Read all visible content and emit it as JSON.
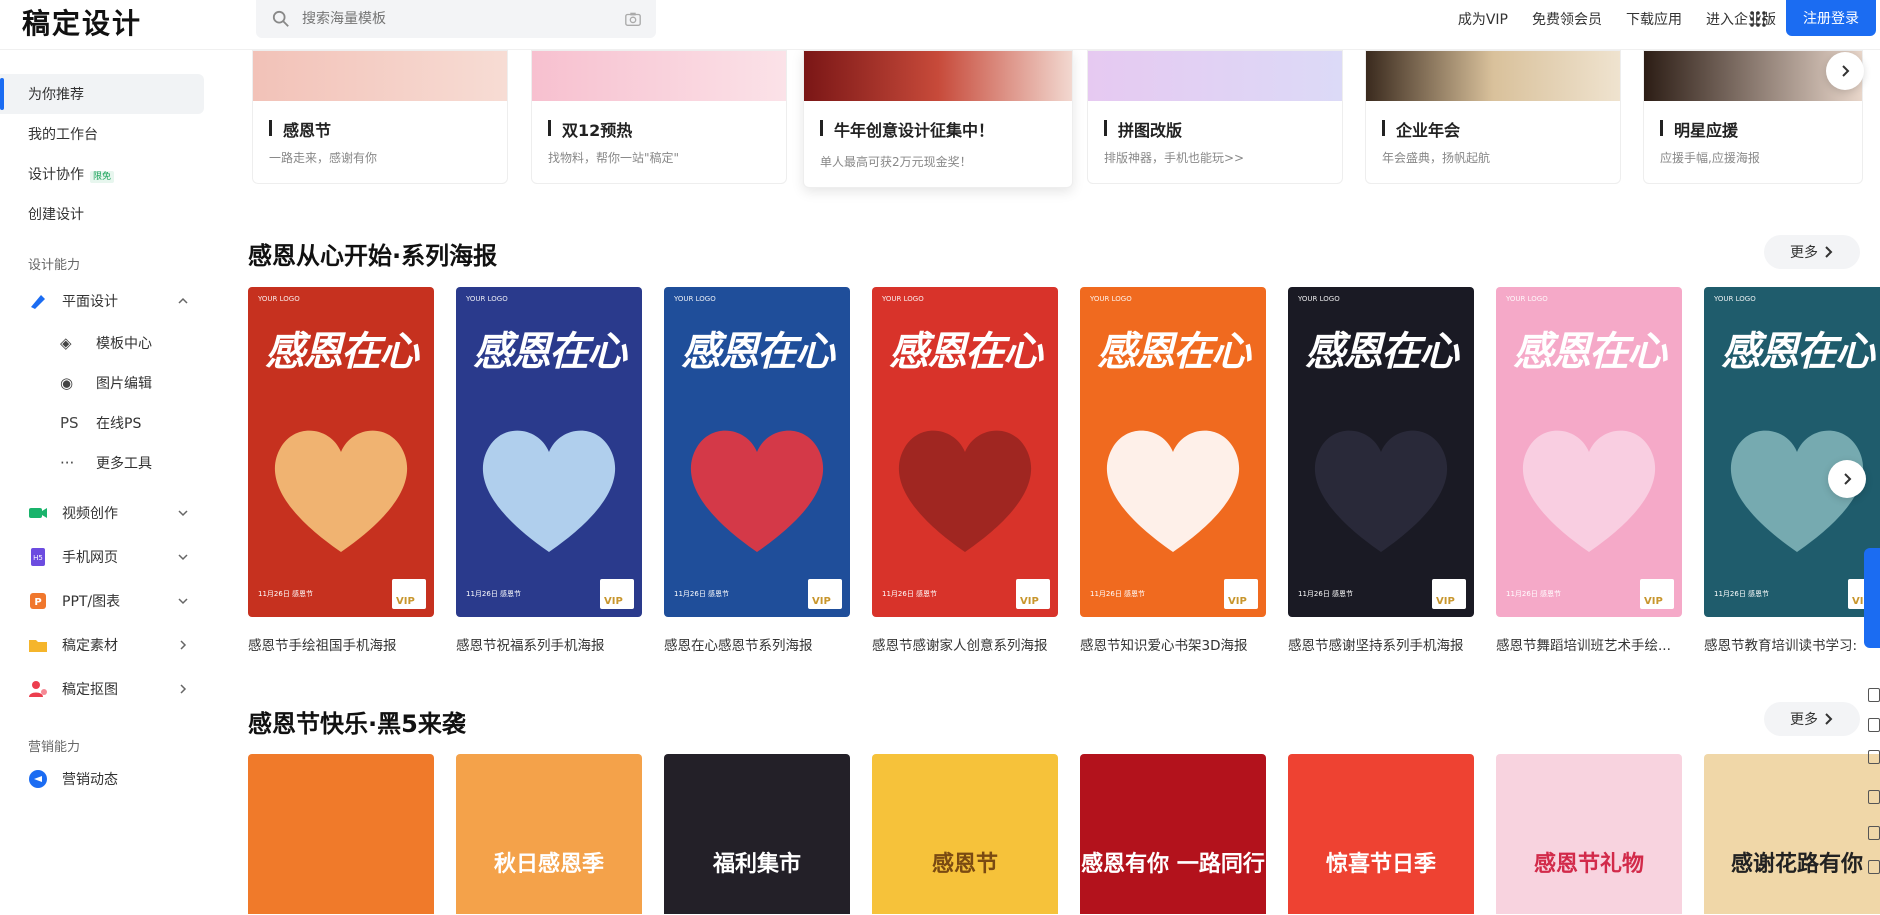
{
  "header": {
    "logo": "稿定设计",
    "search_placeholder": "搜索海量模板",
    "nav": [
      "成为VIP",
      "免费领会员",
      "下载应用",
      "进入企业版"
    ],
    "register_label": "注册登录"
  },
  "sidebar": {
    "items": [
      {
        "label": "为你推荐",
        "active": true
      },
      {
        "label": "我的工作台"
      },
      {
        "label": "设计协作",
        "badge": "限免"
      },
      {
        "label": "创建设计"
      }
    ],
    "section_design": "设计能力",
    "categories": [
      {
        "label": "平面设计",
        "icon": "pen-icon",
        "color": "#1b6cf2",
        "expanded": true
      },
      {
        "label": "视频创作",
        "icon": "video-icon",
        "color": "#19b36b"
      },
      {
        "label": "手机网页",
        "icon": "h5-icon",
        "color": "#6c4ce0"
      },
      {
        "label": "PPT/图表",
        "icon": "ppt-icon",
        "color": "#f0772d"
      },
      {
        "label": "稿定素材",
        "icon": "folder-icon",
        "color": "#f5b52b"
      },
      {
        "label": "稿定抠图",
        "icon": "cutout-icon",
        "color": "#ec3e4e"
      }
    ],
    "sub_items": [
      {
        "label": "模板中心",
        "icon": "layers-icon",
        "glyph": "◈"
      },
      {
        "label": "图片编辑",
        "icon": "edit-icon",
        "glyph": "◉"
      },
      {
        "label": "在线PS",
        "icon": "ps-icon",
        "glyph": "PS"
      },
      {
        "label": "更多工具",
        "icon": "more-icon",
        "glyph": "···"
      }
    ],
    "section_marketing": "营销能力",
    "marketing": {
      "label": "营销动态",
      "icon": "marketing-icon",
      "color": "#1b6cf2"
    }
  },
  "banners": [
    {
      "title": "感恩节",
      "subtitle": "一路走来，感谢有你",
      "color": "#f4c9c2"
    },
    {
      "title": "双12预热",
      "subtitle": "找物料，帮你一站\"稿定\"",
      "color": "#f9d1da"
    },
    {
      "title": "牛年创意设计征集中！",
      "subtitle": "单人最高可获2万元现金奖！",
      "color": "#8e1d1d"
    },
    {
      "title": "拼图改版",
      "subtitle": "排版神器，手机也能玩>>",
      "color": "#d9d6f5"
    },
    {
      "title": "企业年会",
      "subtitle": "年会盛典，扬帆起航",
      "color": "#e7d3b3"
    },
    {
      "title": "明星应援",
      "subtitle": "应援手幅,应援海报",
      "color": "#e8d4c8"
    }
  ],
  "section1": {
    "title": "感恩从心开始·系列海报",
    "more": "更多",
    "posters": [
      {
        "caption": "感恩节手绘祖国手机海报",
        "bg": "#c6311f",
        "heart": "#f4c27a"
      },
      {
        "caption": "感恩节祝福系列手机海报",
        "bg": "#2a3a8c",
        "heart": "#bfe0f7"
      },
      {
        "caption": "感恩在心感恩节系列海报",
        "bg": "#1f4e9a",
        "heart": "#e8373f"
      },
      {
        "caption": "感恩节感谢家人创意系列海报",
        "bg": "#d8332a",
        "heart": "#9a2520"
      },
      {
        "caption": "感恩节知识爱心书架3D海报",
        "bg": "#f06a1f",
        "heart": "#ffffff"
      },
      {
        "caption": "感恩节感谢坚持系列手机海报",
        "bg": "#1a1a24",
        "heart": "#2b2b3c"
      },
      {
        "caption": "感恩节舞蹈培训班艺术手绘...",
        "bg": "#f5a9c8",
        "heart": "#f9d2e3"
      },
      {
        "caption": "感恩节教育培训读书学习:",
        "bg": "#1f5c6c",
        "heart": "#7fb3b8"
      }
    ],
    "poster_title": "感恩在心",
    "poster_logo": "YOUR LOGO",
    "poster_date": "11月26日 感恩节",
    "vip": "VIP"
  },
  "section2": {
    "title": "感恩节快乐·黑5来袭",
    "more": "更多",
    "posters": [
      {
        "bg": "#f07a2a",
        "text": ""
      },
      {
        "bg": "#f4a24a",
        "text": "秋日感恩季"
      },
      {
        "bg": "#232028",
        "text": "福利集市"
      },
      {
        "bg": "#f6c23a",
        "text": "感恩节"
      },
      {
        "bg": "#b3121c",
        "text": "感恩有你 一路同行"
      },
      {
        "bg": "#ee4232",
        "text": "惊喜节日季"
      },
      {
        "bg": "#f8d3df",
        "text": "感恩节礼物"
      },
      {
        "bg": "#f0d7a8",
        "text": "感谢花路有你"
      }
    ]
  }
}
